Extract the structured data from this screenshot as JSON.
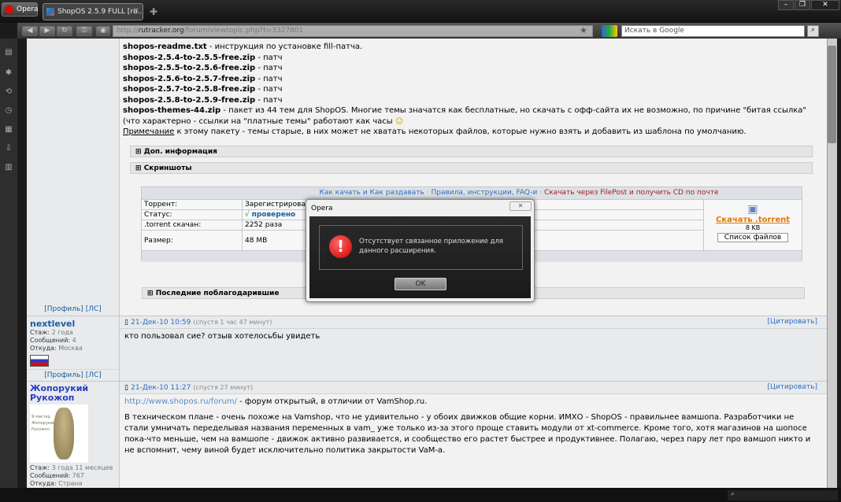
{
  "browser": {
    "app": "Opera",
    "tab_title": "ShopOS 2.5.9 FULL [ru...",
    "url_domain": "rutracker.org",
    "url_path": "/forum/viewtopic.php?t=3327801",
    "url_prefix": "http://",
    "search_placeholder": "Искать в Google"
  },
  "post1": {
    "lines": [
      {
        "file": "shopos-readme.txt",
        "desc": " - инструкция по установке fill-патча."
      },
      {
        "file": "shopos-2.5.4-to-2.5.5-free.zip",
        "desc": " - патч"
      },
      {
        "file": "shopos-2.5.5-to-2.5.6-free.zip",
        "desc": " - патч"
      },
      {
        "file": "shopos-2.5.6-to-2.5.7-free.zip",
        "desc": " - патч"
      },
      {
        "file": "shopos-2.5.7-to-2.5.8-free.zip",
        "desc": " - патч"
      },
      {
        "file": "shopos-2.5.8-to-2.5.9-free.zip",
        "desc": " - патч"
      }
    ],
    "themes_file": "shopos-themes-44.zip",
    "themes_desc": " - пакет из 44 тем для ShopOS. Многие темы значатся как бесплатные, но скачать с офф-сайта их не возможно, по причине \"битая ссылка\" (что характерно - ссылки на \"платные темы\" работают как часы",
    "note_link": "Примечание",
    "note_text": " к этому пакету - темы старые, в них может не хватать некоторых файлов, которые нужно взять и добавить из шаблона по умолчанию.",
    "spoiler1": "Доп. информация",
    "spoiler2": "Скриншоты",
    "spoiler3": "Последние поблагодарившие",
    "torrent": {
      "link1": "Как качать и Как раздавать",
      "link2": "Правила, инструкции, FAQ-и",
      "link3": "Скачать через FilePost и получить CD по почте",
      "sep": "·",
      "rows": [
        {
          "label": "Торрент:",
          "value": "Зарегистрирован"
        },
        {
          "label": "Статус:",
          "value": "проверено"
        },
        {
          "label": ".torrent скачан:",
          "value": "2252 раза"
        },
        {
          "label": "Размер:",
          "value": "48 MB"
        }
      ],
      "download": "Скачать .torrent",
      "size": "8 KB",
      "file_list": "Список файлов"
    },
    "profile": "[Профиль]",
    "pm": "[ЛС]"
  },
  "post2": {
    "nick": "nextlevel",
    "stazh_label": "Стаж:",
    "stazh": "2 года",
    "msgs_label": "Сообщений:",
    "msgs": "4",
    "from_label": "Откуда:",
    "from": "Москва",
    "date": "21-Дек-10 10:59",
    "ago": "(спустя 1 час 47 минут)",
    "quote": "[Цитировать]",
    "text": "кто пользовал сие? отзыв хотелосьбы увидеть",
    "profile": "[Профиль]",
    "pm": "[ЛС]"
  },
  "post3": {
    "nick1": "Жопорукий",
    "nick2": "Рукожоп",
    "avatar_text": "Я мастер Жопорукий Рукожоп",
    "stazh_label": "Стаж:",
    "stazh": "3 года 11 месяцев",
    "msgs_label": "Сообщений:",
    "msgs": "767",
    "from_label": "Откуда:",
    "from": "Страна",
    "date": "21-Дек-10 11:27",
    "ago": "(спустя 27 минут)",
    "quote": "[Цитировать]",
    "link": "http://www.shopos.ru/forum/",
    "link_after": " - форум открытый, в отличии от VamShop.ru.",
    "text": "В техническом плане - очень похоже на Vamshop, что не удивительно - у обоих движков общие корни. ИМХО - ShopOS - правильнее вамшопа. Разработчики не стали умничать переделывая названия переменных в vam_ уже только из-за этого проще ставить модули от xt-commerce. Кроме того, хотя магазинов на шопосе пока-что меньше, чем на вамшопе - движок активно развивается, и сообщество его растет быстрее и продуктивнее. Полагаю, через пару лет про вамшоп никто и не вспомнит, чему виной будет исключительно политика закрытости VaM-а."
  },
  "dialog": {
    "title": "Opera",
    "message": "Отсутствует связанное приложение для данного расширения.",
    "ok": "OK"
  }
}
